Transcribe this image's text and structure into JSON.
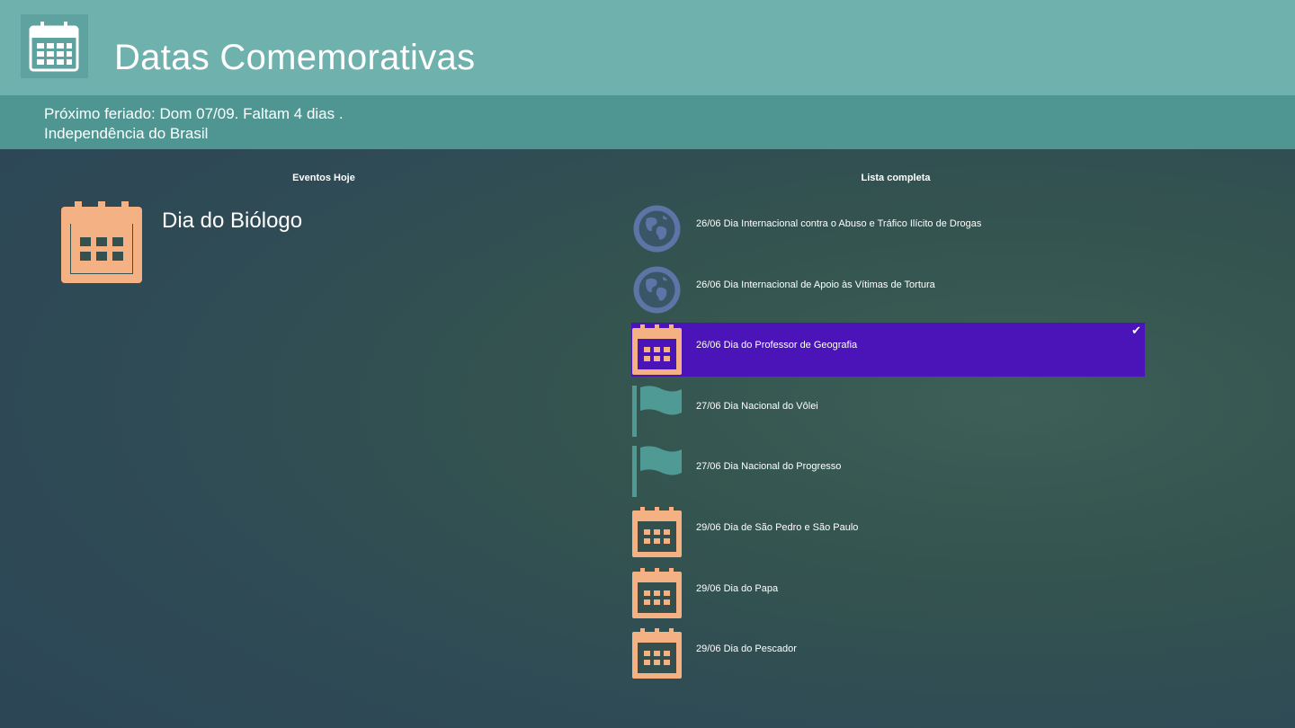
{
  "app": {
    "title": "Datas Comemorativas",
    "icon": "calendar-icon"
  },
  "next_holiday": {
    "line1": "Próximo feriado: Dom 07/09. Faltam 4 dias .",
    "line2": "Independência do Brasil"
  },
  "today": {
    "header": "Eventos Hoje",
    "event": "Dia do Biólogo",
    "icon": "calendar-icon"
  },
  "list": {
    "header": "Lista completa",
    "items": [
      {
        "text": "26/06 Dia Internacional contra o Abuso e Tráfico Ilícito de Drogas",
        "icon": "globe-icon",
        "selected": false
      },
      {
        "text": "26/06 Dia Internacional de Apoio às Vítimas de Tortura",
        "icon": "globe-icon",
        "selected": false
      },
      {
        "text": "26/06 Dia do Professor de Geografia",
        "icon": "calendar-icon",
        "selected": true
      },
      {
        "text": "27/06 Dia Nacional do Vôlei",
        "icon": "flag-icon",
        "selected": false
      },
      {
        "text": "27/06 Dia Nacional do Progresso",
        "icon": "flag-icon",
        "selected": false
      },
      {
        "text": "29/06 Dia de São Pedro e São Paulo",
        "icon": "calendar-icon",
        "selected": false
      },
      {
        "text": "29/06 Dia do Papa",
        "icon": "calendar-icon",
        "selected": false
      },
      {
        "text": "29/06 Dia do Pescador",
        "icon": "calendar-icon",
        "selected": false
      }
    ]
  },
  "colors": {
    "header": "#6fb2ad",
    "holiday_bar": "#4f9693",
    "selection": "#4a14b8",
    "calendar": "#f4b183",
    "globe": "#5d74a6",
    "flag": "#4f9a95"
  }
}
